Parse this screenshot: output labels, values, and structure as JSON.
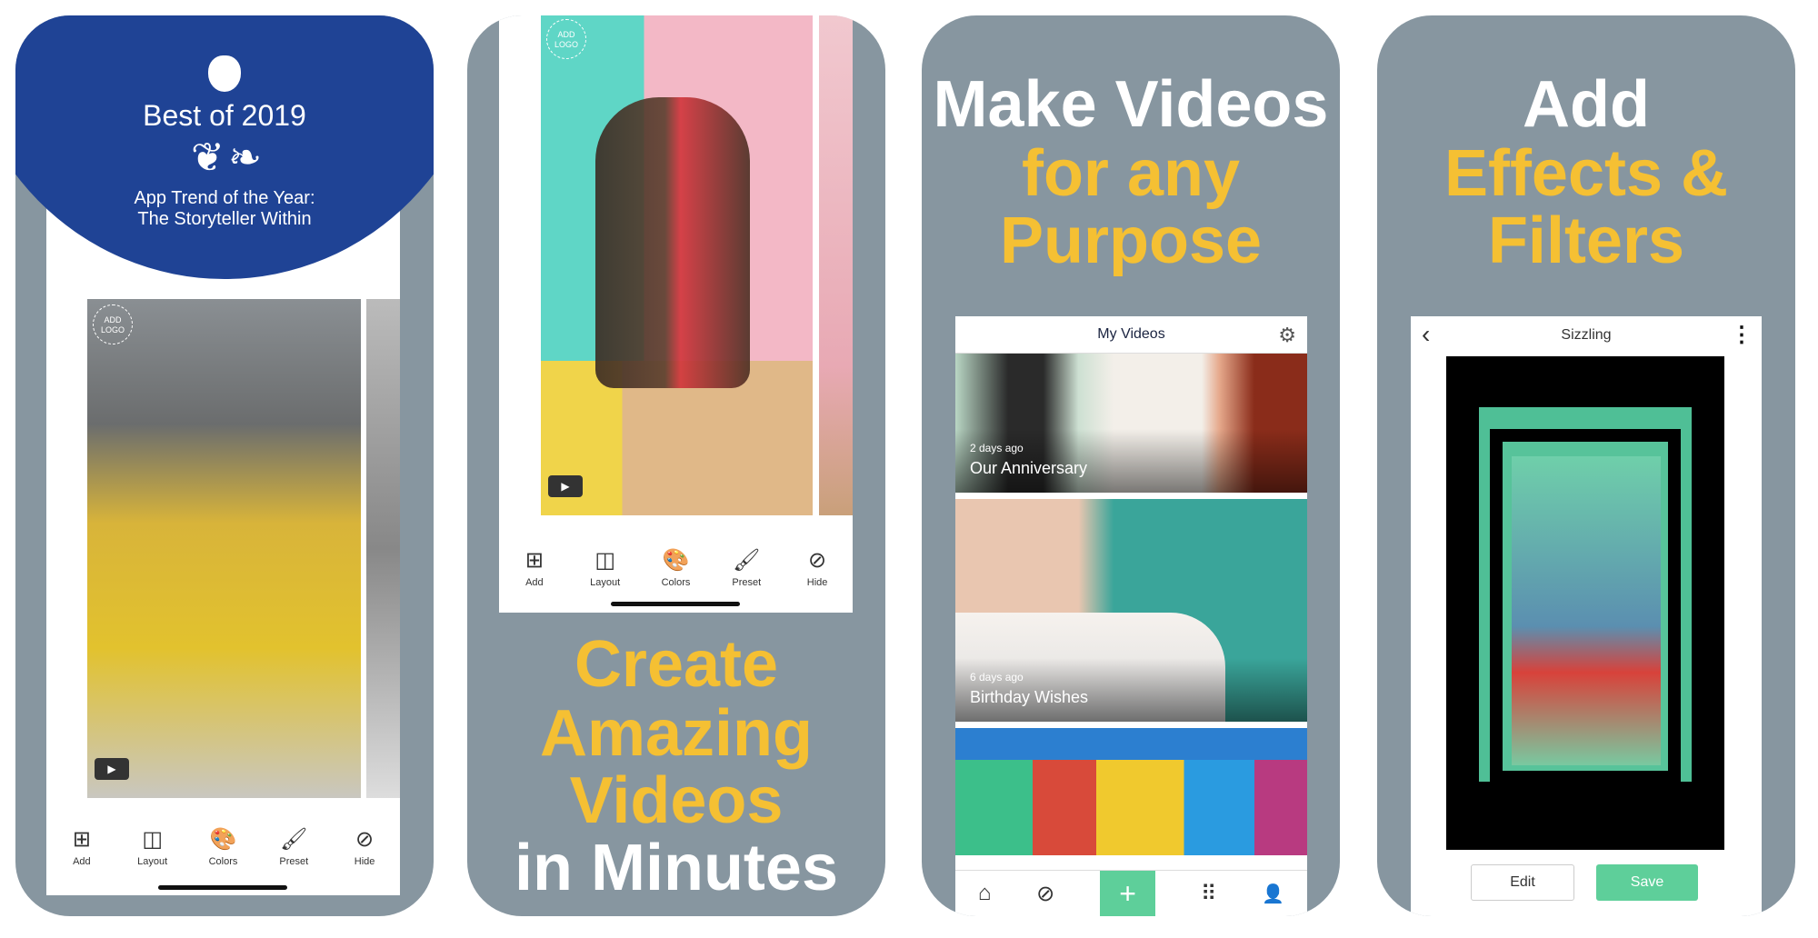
{
  "colors": {
    "panel": "#8796a0",
    "yellow": "#f5c033",
    "blue": "#1f4395",
    "green": "#5ecf9a"
  },
  "panel1": {
    "award_icon": "apple-icon",
    "award_title": "Best of 2019",
    "award_line1": "App Trend of the Year:",
    "award_line2": "The Storyteller Within",
    "add_logo": "ADD LOGO",
    "play": "▶",
    "toolbar": [
      {
        "icon": "add-icon",
        "glyph": "⊞",
        "label": "Add"
      },
      {
        "icon": "layout-icon",
        "glyph": "◫",
        "label": "Layout"
      },
      {
        "icon": "palette-icon",
        "glyph": "🎨",
        "label": "Colors"
      },
      {
        "icon": "paint-roller-icon",
        "glyph": "🖌",
        "label": "Preset"
      },
      {
        "icon": "eye-slash-icon",
        "glyph": "⊘",
        "label": "Hide"
      }
    ]
  },
  "panel2": {
    "add_logo": "ADD LOGO",
    "play": "▶",
    "headline": [
      "Create",
      "Amazing",
      "Videos",
      "in Minutes"
    ],
    "toolbar": [
      {
        "icon": "add-icon",
        "glyph": "⊞",
        "label": "Add"
      },
      {
        "icon": "layout-icon",
        "glyph": "◫",
        "label": "Layout"
      },
      {
        "icon": "palette-icon",
        "glyph": "🎨",
        "label": "Colors"
      },
      {
        "icon": "paint-roller-icon",
        "glyph": "🖌",
        "label": "Preset"
      },
      {
        "icon": "eye-slash-icon",
        "glyph": "⊘",
        "label": "Hide"
      }
    ]
  },
  "panel3": {
    "headline": [
      "Make Videos",
      "for any",
      "Purpose"
    ],
    "header_title": "My Videos",
    "settings_glyph": "⚙",
    "videos": [
      {
        "ago": "2 days ago",
        "title": "Our Anniversary"
      },
      {
        "ago": "6 days ago",
        "title": "Birthday Wishes"
      },
      {
        "ago": "",
        "title": ""
      }
    ],
    "tabs": [
      {
        "icon": "home-icon",
        "glyph": "⌂"
      },
      {
        "icon": "compass-icon",
        "glyph": "⊘"
      },
      {
        "icon": "plus-icon",
        "glyph": "+"
      },
      {
        "icon": "grid-icon",
        "glyph": "⠿"
      },
      {
        "icon": "profile-icon",
        "glyph": "👤"
      }
    ]
  },
  "panel4": {
    "headline": [
      "Add",
      "Effects &",
      "Filters"
    ],
    "header_title": "Sizzling",
    "back_glyph": "‹",
    "more_glyph": "⋮",
    "edit_label": "Edit",
    "save_label": "Save"
  }
}
